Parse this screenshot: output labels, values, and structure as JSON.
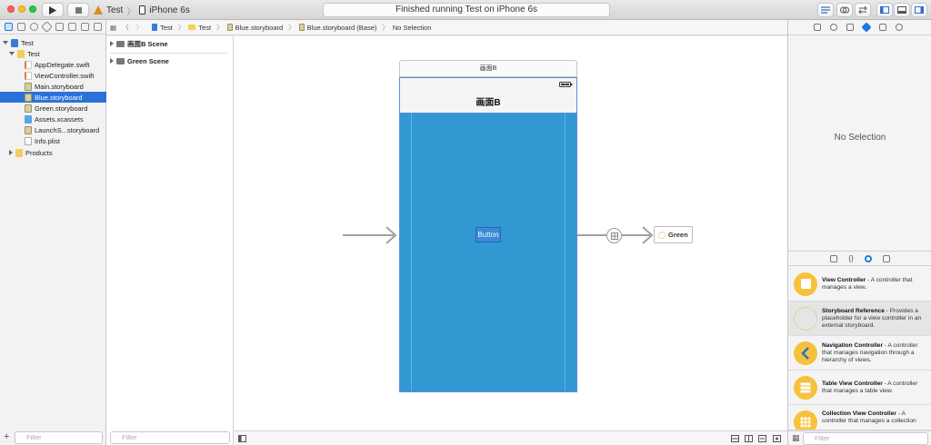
{
  "toolbar": {
    "scheme_target": "Test",
    "scheme_device": "iPhone 6s",
    "status": "Finished running Test on iPhone 6s"
  },
  "navigator": {
    "items": [
      {
        "label": "Test",
        "kind": "project"
      },
      {
        "label": "Test",
        "kind": "folder"
      },
      {
        "label": "AppDelegate.swift",
        "kind": "swift"
      },
      {
        "label": "ViewController.swift",
        "kind": "swift"
      },
      {
        "label": "Main.storyboard",
        "kind": "storyboard"
      },
      {
        "label": "Blue.storyboard",
        "kind": "storyboard"
      },
      {
        "label": "Green.storyboard",
        "kind": "storyboard"
      },
      {
        "label": "Assets.xcassets",
        "kind": "assets"
      },
      {
        "label": "LaunchS...storyboard",
        "kind": "storyboard"
      },
      {
        "label": "Info.plist",
        "kind": "plist"
      },
      {
        "label": "Products",
        "kind": "folder"
      }
    ],
    "filter_placeholder": "Filter"
  },
  "outline": {
    "scenes": [
      "画面B Scene",
      "Green Scene"
    ],
    "filter_placeholder": "Filter"
  },
  "jumpbar": {
    "crumbs": [
      "Test",
      "Test",
      "Blue.storyboard",
      "Blue.storyboard (Base)",
      "No Selection"
    ]
  },
  "canvas": {
    "scene_title": "画面B",
    "nav_title": "画面B",
    "button_label": "Button",
    "reference_label": "Green",
    "accent_blue": "#3198d2"
  },
  "inspector": {
    "empty_label": "No Selection",
    "library": [
      {
        "title": "View Controller",
        "desc": " - A controller that manages a view."
      },
      {
        "title": "Storyboard Reference",
        "desc": " - Provides a placeholder for a view controller in an external storyboard."
      },
      {
        "title": "Navigation Controller",
        "desc": " - A controller that manages navigation through a hierarchy of views."
      },
      {
        "title": "Table View Controller",
        "desc": " - A controller that manages a table view."
      },
      {
        "title": "Collection View Controller",
        "desc": " - A controller that manages a collection"
      }
    ],
    "filter_placeholder": "Filter"
  }
}
